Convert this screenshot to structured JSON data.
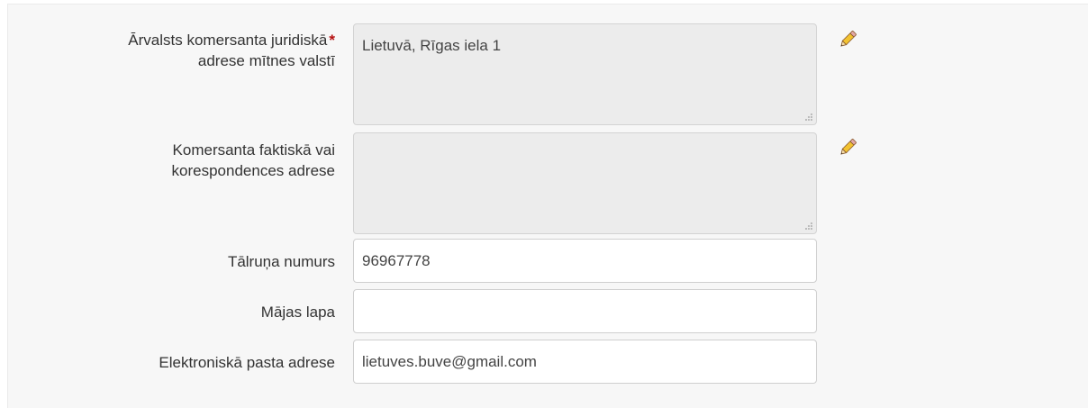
{
  "form": {
    "foreign_address": {
      "label_line1": "Ārvalsts komersanta juridiskā",
      "required_mark": "*",
      "label_line2": "adrese mītnes valstī",
      "value": "Lietuvā, Rīgas iela 1"
    },
    "actual_address": {
      "label_line1": "Komersanta faktiskā vai",
      "label_line2": "korespondences adrese",
      "value": ""
    },
    "phone": {
      "label": "Tālruņa numurs",
      "value": "96967778"
    },
    "homepage": {
      "label": "Mājas lapa",
      "value": ""
    },
    "email": {
      "label": "Elektroniskā pasta adrese",
      "value": "lietuves.buve@gmail.com"
    }
  },
  "icons": {
    "edit": "pencil-icon",
    "resize": "resize-grip-icon"
  },
  "colors": {
    "required": "#b50f0f",
    "readonly_bg": "#ececec",
    "panel_bg": "#f7f7f7"
  }
}
